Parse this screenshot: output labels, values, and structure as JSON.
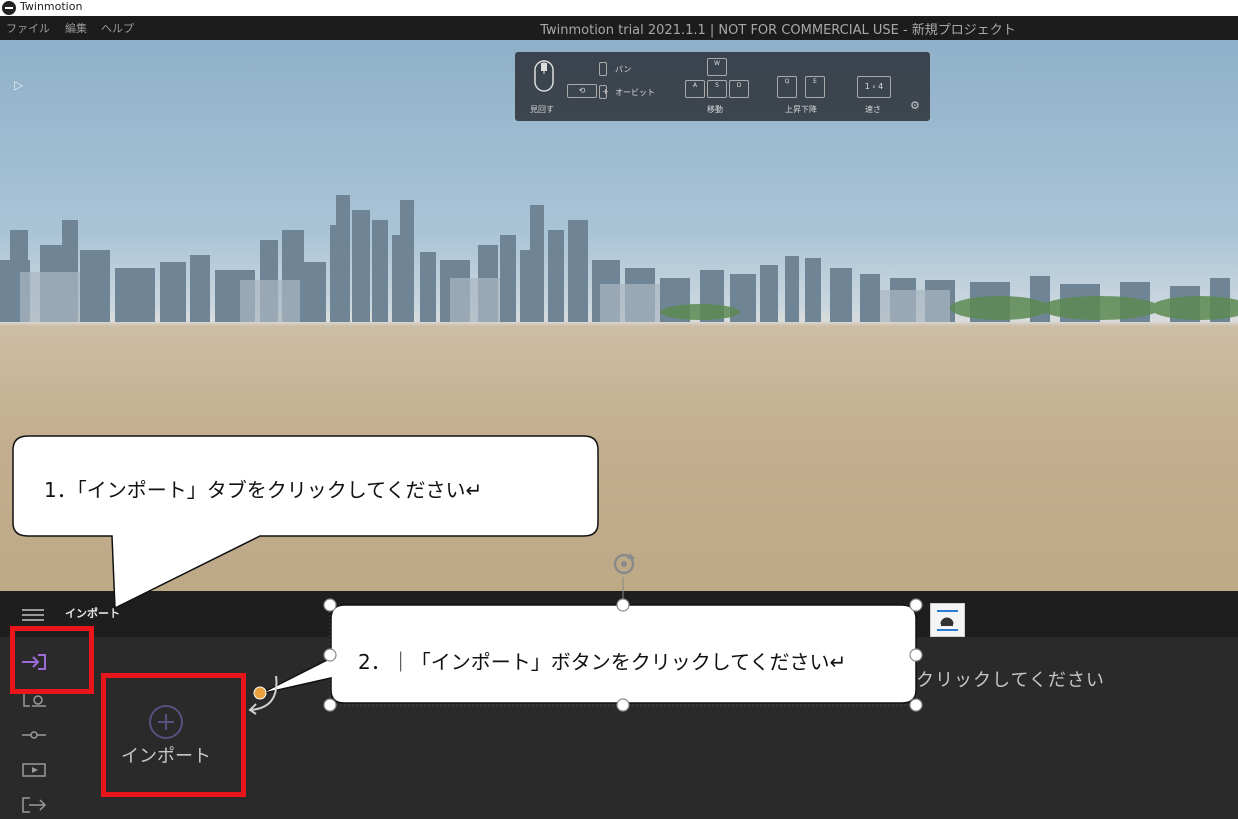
{
  "os_window": {
    "title": "Twinmotion"
  },
  "menu": {
    "items": [
      "ファイル",
      "編集",
      "ヘルプ"
    ]
  },
  "app_title": "Twinmotion trial 2021.1.1 | NOT FOR COMMERCIAL USE - 新規プロジェクト",
  "nav_panel": {
    "look": "見回す",
    "pan": "パン",
    "orbit": "オービット",
    "move": "移動",
    "updown": "上昇下降",
    "speed": "速さ",
    "speed_value": "1 ‹ 4",
    "keys": {
      "w": "W",
      "a": "A",
      "s": "S",
      "d": "D",
      "q": "Q",
      "e": "E"
    }
  },
  "dock": {
    "tab_title": "インポート",
    "import_button_label": "インポート",
    "hint_text": "クリックしてください"
  },
  "callouts": {
    "step1": "1．「インポート」タブをクリックしてください↵",
    "step2": "2．｜「インポート」ボタンをクリックしてください↵"
  },
  "icons": {
    "import_tab": "import-tab-icon",
    "settings": "gear-icon",
    "play_toggle": "play-triangle-icon",
    "rotate_handle": "rotate-handle-icon"
  },
  "colors": {
    "highlight": "#e8161b",
    "accent_purple": "#9b6bd6",
    "handle_orange": "#e8a13c"
  }
}
